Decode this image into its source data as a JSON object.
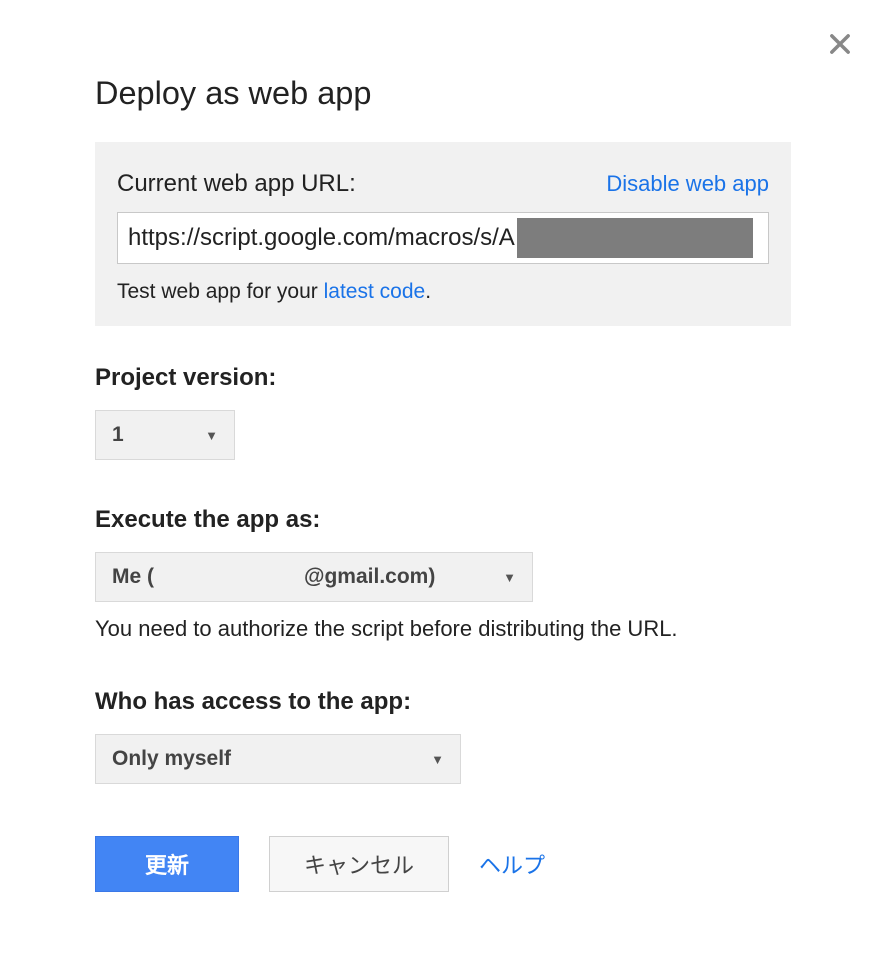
{
  "dialog": {
    "title": "Deploy as web app",
    "urlPanel": {
      "label": "Current web app URL:",
      "disableLink": "Disable web app",
      "urlValue": "https://script.google.com/macros/s/A",
      "testPrefix": "Test web app for your ",
      "testLink": "latest code",
      "testSuffix": "."
    },
    "projectVersion": {
      "label": "Project version:",
      "value": "1"
    },
    "executeAs": {
      "label": "Execute the app as:",
      "prefix": "Me (",
      "suffix": "@gmail.com)",
      "helpText": "You need to authorize the script before distributing the URL."
    },
    "access": {
      "label": "Who has access to the app:",
      "value": "Only myself"
    },
    "buttons": {
      "primary": "更新",
      "secondary": "キャンセル",
      "help": "ヘルプ"
    }
  }
}
